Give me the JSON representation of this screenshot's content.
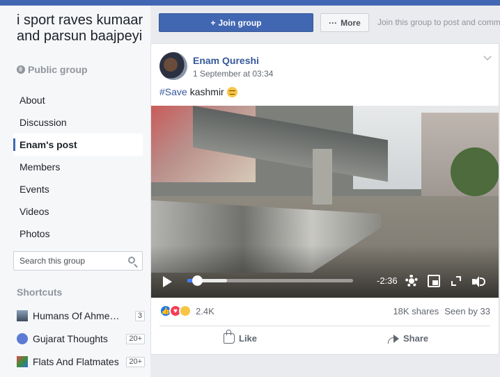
{
  "group": {
    "title": "i sport raves kumaar and parsun baajpeyi",
    "privacy": "Public group"
  },
  "nav": {
    "items": [
      {
        "label": "About"
      },
      {
        "label": "Discussion"
      },
      {
        "label": "Enam's post",
        "active": true
      },
      {
        "label": "Members"
      },
      {
        "label": "Events"
      },
      {
        "label": "Videos"
      },
      {
        "label": "Photos"
      }
    ]
  },
  "search": {
    "placeholder": "Search this group"
  },
  "shortcuts": {
    "heading": "Shortcuts",
    "items": [
      {
        "label": "Humans Of Ahmedabad",
        "badge": "3"
      },
      {
        "label": "Gujarat Thoughts",
        "badge": "20+"
      },
      {
        "label": "Flats And Flatmates",
        "badge": "20+"
      }
    ]
  },
  "actions": {
    "join_label": "Join group",
    "join_icon": "+",
    "more_label": "More",
    "more_icon": "···",
    "hint": "Join this group to post and comment"
  },
  "post": {
    "author": "Enam Qureshi",
    "timestamp": "1 September at 03:34",
    "hashtag": "#Save",
    "text": "kashmir",
    "video": {
      "time_remaining": "-2:36",
      "progress": 0.06,
      "buffered": 0.24
    },
    "reactions": {
      "count": "2.4K",
      "types": [
        "like",
        "love",
        "sad"
      ]
    },
    "shares": "18K shares",
    "seen_by": "Seen by 33",
    "like_label": "Like",
    "share_label": "Share"
  },
  "colors": {
    "brand": "#4267b2",
    "link": "#365899",
    "progress": "#4080ff"
  }
}
